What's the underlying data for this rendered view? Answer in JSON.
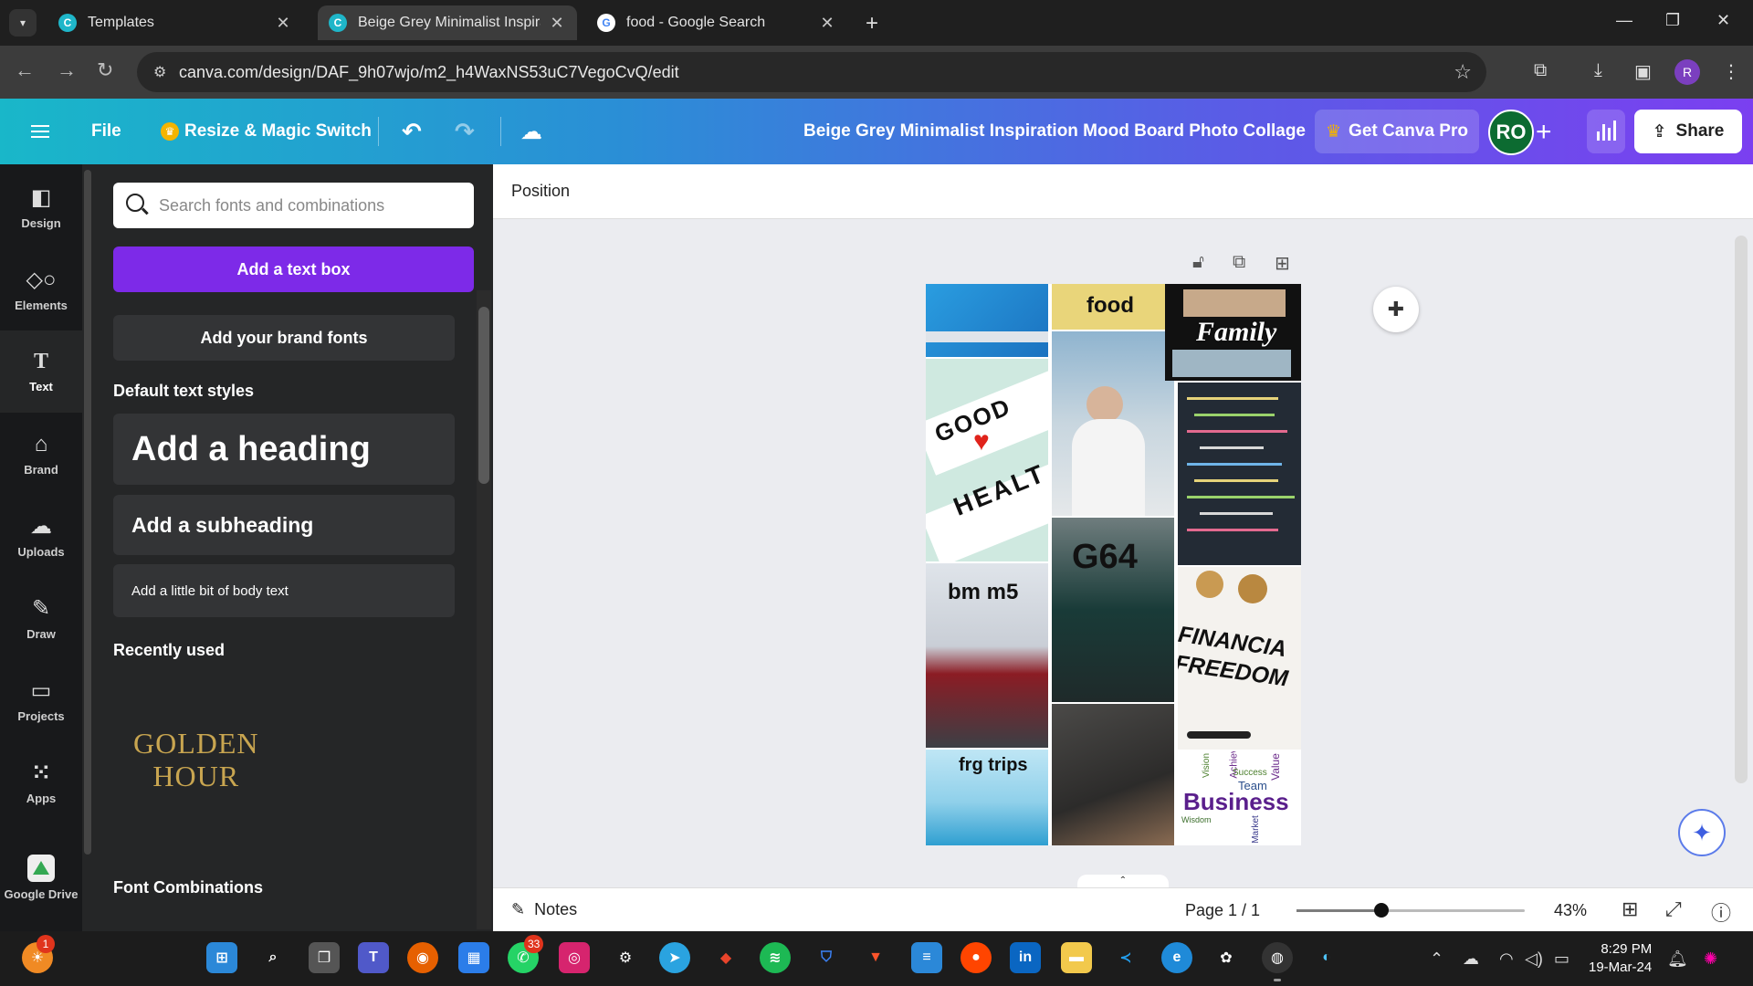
{
  "browser": {
    "tabs": [
      {
        "title": "Templates",
        "active": false
      },
      {
        "title": "Beige Grey Minimalist Inspiratic",
        "active": true
      },
      {
        "title": "food - Google Search",
        "active": false
      }
    ],
    "close_glyph": "✕",
    "new_tab_glyph": "+",
    "url": "canva.com/design/DAF_9h07wjo/m2_h4WaxNS53uC7VegoCvQ/edit",
    "profile_initial": "R"
  },
  "header": {
    "file_label": "File",
    "resize_label": "Resize & Magic Switch",
    "design_title": "Beige Grey Minimalist Inspiration Mood Board Photo Collage",
    "get_pro_label": "Get Canva Pro",
    "avatar_initials": "RO",
    "share_label": "Share"
  },
  "rail": {
    "items": [
      {
        "label": "Design",
        "icon": "design-icon"
      },
      {
        "label": "Elements",
        "icon": "elements-icon"
      },
      {
        "label": "Text",
        "icon": "text-icon",
        "active": true
      },
      {
        "label": "Brand",
        "icon": "brand-icon"
      },
      {
        "label": "Uploads",
        "icon": "uploads-icon"
      },
      {
        "label": "Draw",
        "icon": "draw-icon"
      },
      {
        "label": "Projects",
        "icon": "projects-icon"
      },
      {
        "label": "Apps",
        "icon": "apps-icon"
      },
      {
        "label": "Google Drive",
        "icon": "google-drive-icon"
      }
    ]
  },
  "panel": {
    "search_placeholder": "Search fonts and combinations",
    "add_text_box": "Add a text box",
    "add_brand_fonts": "Add your brand fonts",
    "default_styles_label": "Default text styles",
    "heading": "Add a heading",
    "subheading": "Add a subheading",
    "body_text": "Add a little bit of body text",
    "recently_used_label": "Recently used",
    "recent_font_line1": "GOLDEN",
    "recent_font_line2": "HOUR",
    "font_combinations_label": "Font Combinations"
  },
  "canvas": {
    "toolbar_label": "Position",
    "tiles": {
      "food": "food",
      "family": "Family",
      "good": "GOOD",
      "health": "HEALT",
      "g64": "G64",
      "bm_m5": "bm m5",
      "financial": "FINANCIA",
      "freedom": "FREEDOM",
      "frg_trips": "frg trips",
      "business": "Business",
      "wordcloud_words": [
        "Achieve",
        "Vision",
        "Success",
        "Team",
        "Value",
        "Wisdom",
        "Market"
      ]
    }
  },
  "footer": {
    "notes_label": "Notes",
    "page_info": "Page 1 / 1",
    "zoom_percent": 43,
    "zoom_label": "43%"
  },
  "taskbar": {
    "badges": {
      "firefox_like": "1",
      "whatsapp": "33"
    },
    "time": "8:29 PM",
    "date": "19-Mar-24"
  },
  "colors": {
    "header_gradient_start": "#19b7c9",
    "header_gradient_end": "#7b3ff0",
    "primary_button": "#7d2ae8",
    "avatar_bg": "#0c6b31"
  }
}
